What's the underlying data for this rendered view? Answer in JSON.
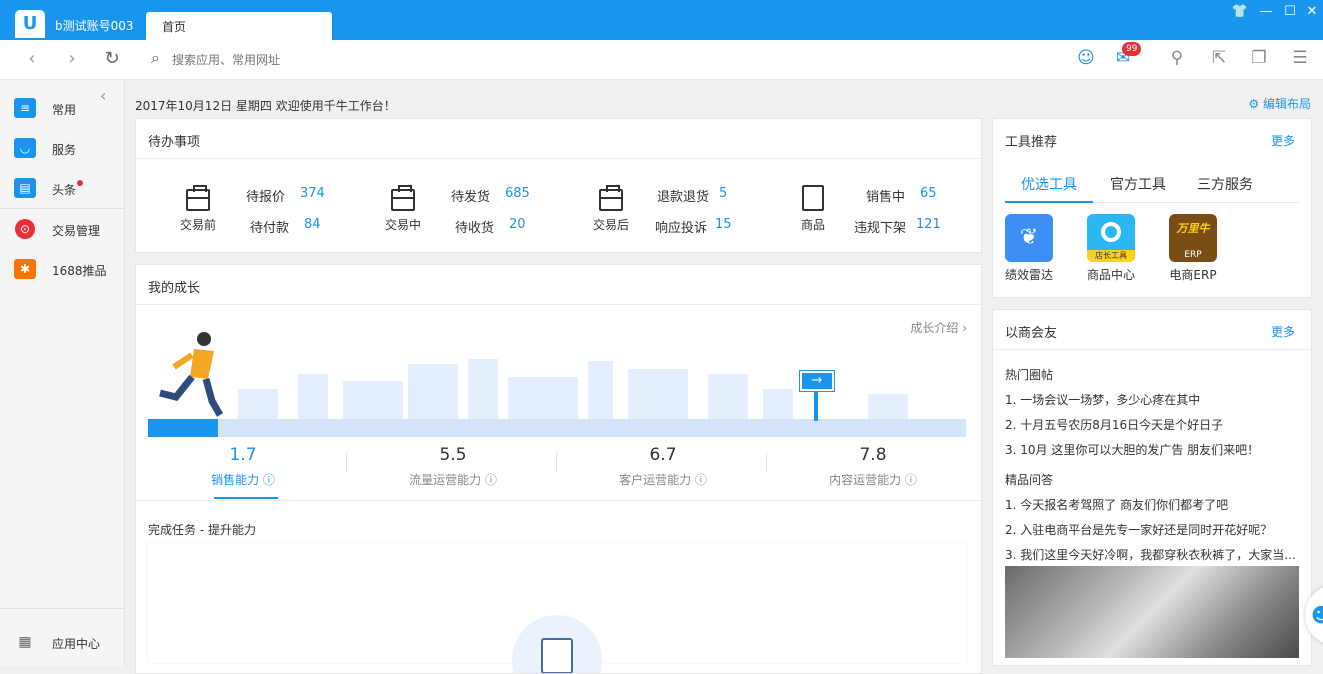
{
  "window": {
    "account": "b测试账号003",
    "tab_label": "首页",
    "logo_glyph": "U",
    "win_icons": [
      "skin-icon",
      "minimize-icon",
      "maximize-icon",
      "close-icon"
    ]
  },
  "toolbar": {
    "search_placeholder": "搜索应用、常用网址",
    "mail_badge": "99"
  },
  "sidebar": {
    "items": [
      {
        "label": "常用",
        "icon": "list-icon",
        "color": "#1a95ef"
      },
      {
        "label": "服务",
        "icon": "bag-icon",
        "color": "#1a95ef"
      },
      {
        "label": "头条",
        "icon": "news-icon",
        "color": "#1a95ef"
      },
      {
        "label": "交易管理",
        "icon": "trade-icon",
        "color": "#e9303a"
      },
      {
        "label": "1688推品",
        "icon": "1688-icon",
        "color": "#ff7300"
      }
    ],
    "app_center": "应用中心"
  },
  "main": {
    "date_line": "2017年10月12日 星期四 欢迎使用千牛工作台！",
    "edit_layout": "编辑布局"
  },
  "todo": {
    "title": "待办事项",
    "groups": [
      {
        "label": "交易前",
        "rows": [
          {
            "k": "待报价",
            "v": "374"
          },
          {
            "k": "待付款",
            "v": "84"
          }
        ]
      },
      {
        "label": "交易中",
        "rows": [
          {
            "k": "待发货",
            "v": "685"
          },
          {
            "k": "待收货",
            "v": "20"
          }
        ]
      },
      {
        "label": "交易后",
        "rows": [
          {
            "k": "退款退货",
            "v": "5"
          },
          {
            "k": "响应投诉",
            "v": "15"
          }
        ]
      },
      {
        "label": "商品",
        "rows": [
          {
            "k": "销售中",
            "v": "65"
          },
          {
            "k": "违规下架",
            "v": "121"
          }
        ]
      }
    ]
  },
  "growth": {
    "title": "我的成长",
    "intro": "成长介绍 ›",
    "metrics": [
      {
        "value": "1.7",
        "label": "销售能力 ⓘ"
      },
      {
        "value": "5.5",
        "label": "流量运营能力 ⓘ"
      },
      {
        "value": "6.7",
        "label": "客户运营能力 ⓘ"
      },
      {
        "value": "7.8",
        "label": "内容运营能力 ⓘ"
      }
    ],
    "tasks_title": "完成任务 - 提升能力"
  },
  "tools": {
    "title": "工具推荐",
    "more": "更多",
    "tabs": [
      "优选工具",
      "官方工具",
      "三方服务"
    ],
    "items": [
      {
        "label": "绩效雷达",
        "color": "#3d8ef7"
      },
      {
        "label": "商品中心",
        "color": "#2ab8f5"
      },
      {
        "label": "电商ERP",
        "color": "#7a4d14"
      }
    ],
    "tile_badges": [
      "店长工具",
      "万里牛",
      "ERP"
    ]
  },
  "social": {
    "title": "以商会友",
    "more": "更多",
    "hot_title": "热门圈帖",
    "hot": [
      "1. 一场会议一场梦，多少心疼在其中",
      "2. 十月五号农历8月16日今天是个好日子",
      "3. 10月 这里你可以大胆的发广告 朋友们来吧！"
    ],
    "qa_title": "精品问答",
    "qa": [
      "1. 今天报名考驾照了 商友们你们都考了吧",
      "2. 入驻电商平台是先专一家好还是同时开花好呢？",
      "3. 我们这里今天好冷啊，我都穿秋衣秋裤了，大家当..."
    ]
  }
}
